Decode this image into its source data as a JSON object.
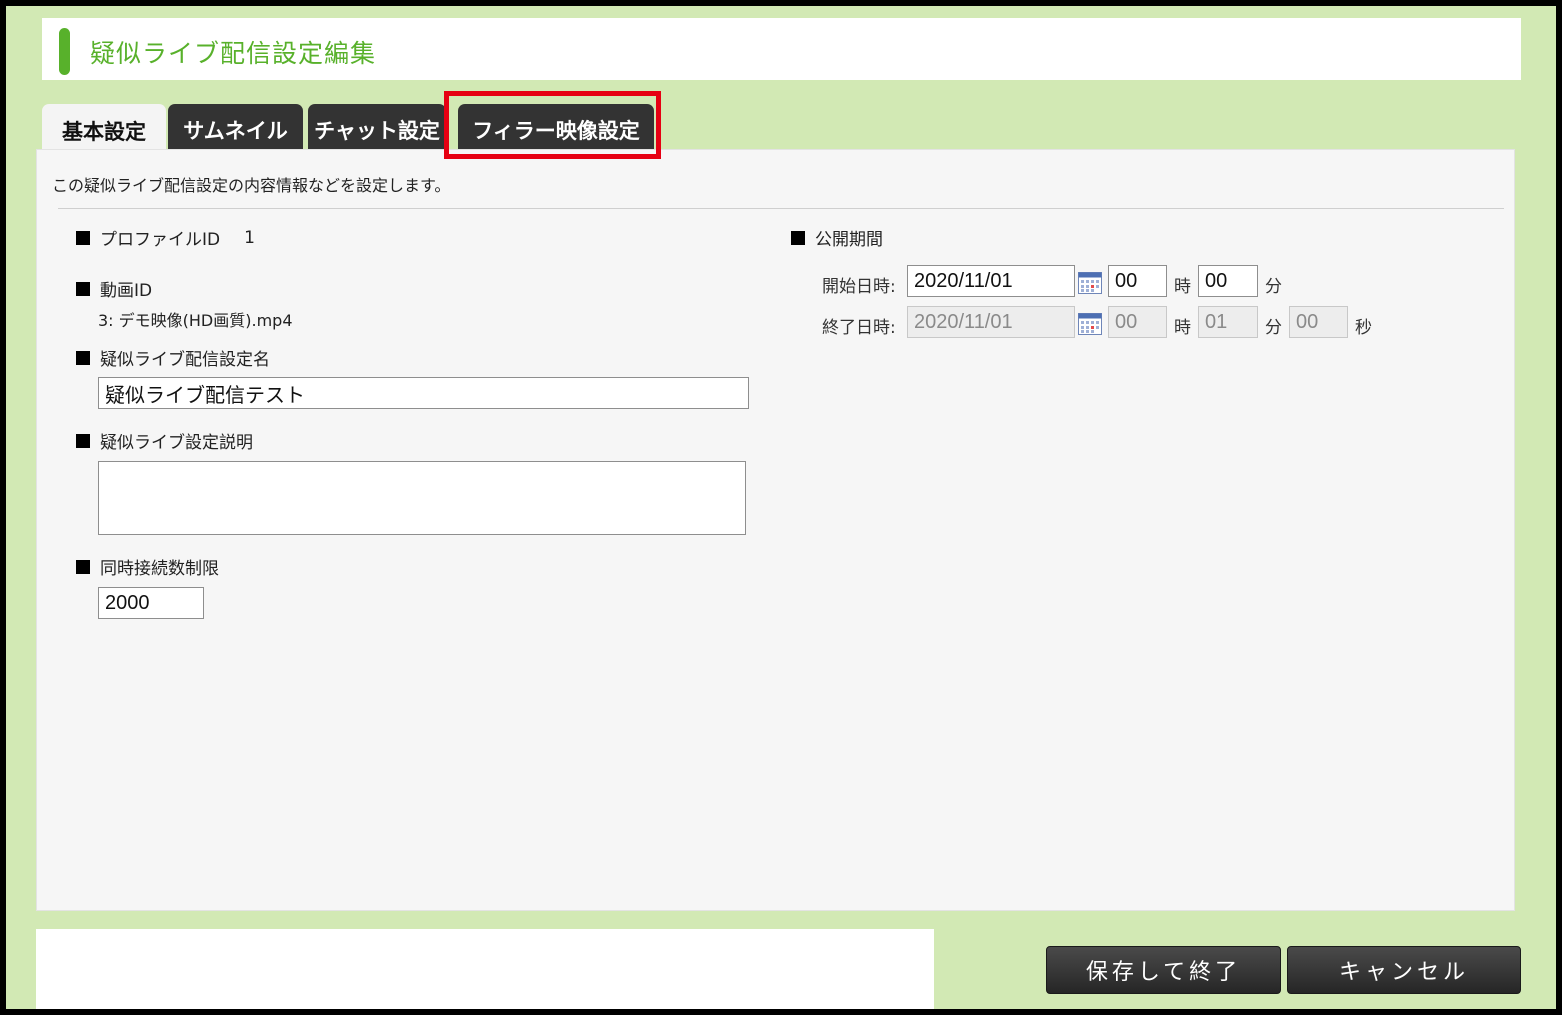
{
  "page": {
    "title": "疑似ライブ配信設定編集"
  },
  "tabs": [
    {
      "label": "基本設定",
      "active": true
    },
    {
      "label": "サムネイル",
      "active": false
    },
    {
      "label": "チャット設定",
      "active": false
    },
    {
      "label": "フィラー映像設定",
      "active": false,
      "highlighted": true
    }
  ],
  "description": "この疑似ライブ配信設定の内容情報などを設定します。",
  "left": {
    "profile_id": {
      "label": "プロファイルID",
      "value": "1"
    },
    "video_id": {
      "label": "動画ID",
      "value": "3: デモ映像(HD画質).mp4"
    },
    "setting_name": {
      "label": "疑似ライブ配信設定名",
      "value": "疑似ライブ配信テスト"
    },
    "setting_desc": {
      "label": "疑似ライブ設定説明",
      "value": ""
    },
    "connection_limit": {
      "label": "同時接続数制限",
      "value": "2000"
    }
  },
  "period": {
    "label": "公開期間",
    "start": {
      "label": "開始日時:",
      "date": "2020/11/01",
      "hour": "00",
      "hour_unit": "時",
      "minute": "00",
      "minute_unit": "分"
    },
    "end": {
      "label": "終了日時:",
      "date": "2020/11/01",
      "hour": "00",
      "hour_unit": "時",
      "minute": "01",
      "minute_unit": "分",
      "second": "00",
      "second_unit": "秒"
    }
  },
  "buttons": {
    "save": "保存して終了",
    "cancel": "キャンセル"
  },
  "colors": {
    "accent": "#58b12b",
    "background": "#d2e9b4",
    "highlight": "#e60012",
    "tab_dark": "#333333"
  },
  "icons": {
    "calendar": "calendar-icon"
  }
}
